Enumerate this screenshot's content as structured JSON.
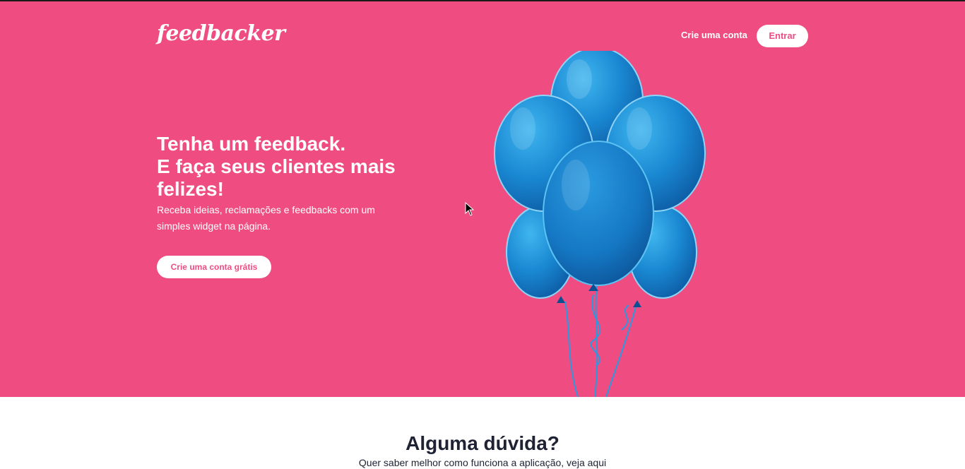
{
  "header": {
    "logo_text": "feedbacker",
    "signup_link": "Crie uma conta",
    "login_button": "Entrar"
  },
  "hero": {
    "headline_line1": "Tenha um feedback.",
    "headline_line2": "E faça seus clientes mais felizes!",
    "subtext": "Receba ideias, reclamações e feedbacks com um simples widget na página.",
    "cta_button": "Crie uma conta grátis",
    "image": "blue-balloons"
  },
  "faq": {
    "title": "Alguma dúvida?",
    "subtitle": "Quer saber melhor como funciona a aplicação, veja aqui"
  },
  "colors": {
    "brand": "#ef4c82",
    "balloon": "#1e88d0",
    "text_dark": "#1e2233"
  }
}
